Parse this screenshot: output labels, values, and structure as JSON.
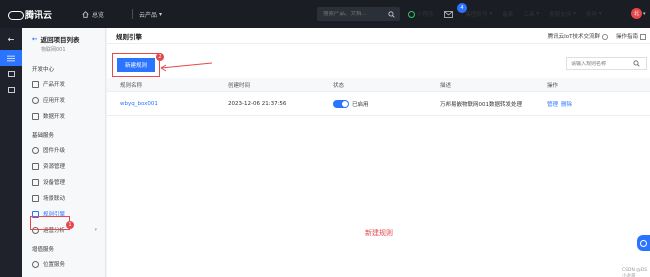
{
  "topnav": {
    "brand": "腾讯云",
    "home": "总览",
    "products": "云产品",
    "search_placeholder": "搜索产品、文档...",
    "mini_program": "小程序",
    "mail_badge": "4",
    "group_account": "集团账号",
    "filing": "备案",
    "tools": "工具",
    "support": "客服支持",
    "billing": "费用",
    "avatar_text": "北"
  },
  "sidebar": {
    "back_label": "返回项目列表",
    "project_name": "物联网001",
    "groups": [
      {
        "title": "开发中心",
        "items": [
          "产品开发",
          "应用开发",
          "数据开发"
        ]
      },
      {
        "title": "基础服务",
        "items": [
          "固件升级",
          "资源管理",
          "设备管理",
          "场景联动",
          "规则引擎",
          "运营分析"
        ]
      },
      {
        "title": "增值服务",
        "items": [
          "位置服务"
        ]
      }
    ],
    "active_badge": "1"
  },
  "main": {
    "title": "规则引擎",
    "community": "腾讯云IoT技术交流群",
    "guide": "操作指南",
    "create_button": "新建规则",
    "create_badge": "2",
    "search_placeholder": "请输入规则名称",
    "columns": [
      "规则名称",
      "创建时间",
      "状态",
      "描述",
      "操作"
    ],
    "rows": [
      {
        "name": "wbyq_box001",
        "created": "2023-12-06 21:37:56",
        "status": "已启用",
        "desc": "万邦易嵌物联网001数据转发处理",
        "actions": [
          "管理",
          "删除"
        ]
      }
    ],
    "annotation": "新建规则"
  },
  "watermark": "CSDN @DS小龙哥"
}
